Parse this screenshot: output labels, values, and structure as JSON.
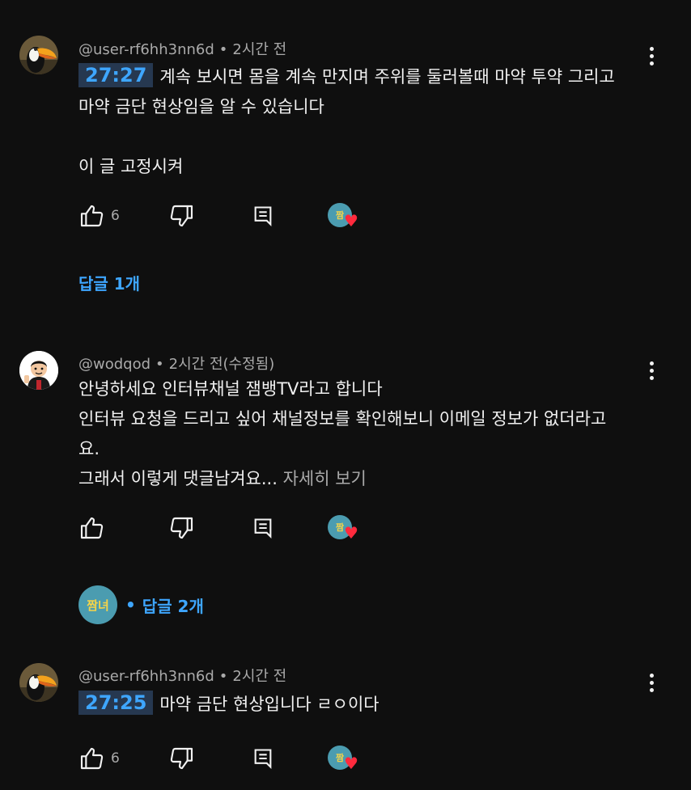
{
  "colors": {
    "background": "#0f0f0f",
    "text": "#f1f1f1",
    "muted": "#aaaaaa",
    "link": "#3ea6ff",
    "timestamp_bg": "#263850",
    "heart": "#ff2a3d",
    "creator_avatar": "#4b9cb0"
  },
  "comments": [
    {
      "handle": "@user-rf6hh3nn6d",
      "separator": "•",
      "time": "2시간 전",
      "timestamp": "27:27",
      "line1": "계속 보시면 몸을 계속 만지며 주위를 둘러볼때 마약 투약 그리고",
      "line2": "마약 금단 현상임을 알 수 있습니다",
      "line3": "이 글 고정시켜",
      "likes": "6",
      "creator_badge": "짬",
      "avatar_icon": "toucan-avatar-icon",
      "replies_label": "답글 1개"
    },
    {
      "handle": "@wodqod",
      "separator": "•",
      "time": "2시간 전(수정됨)",
      "line1": "안녕하세요 인터뷰채널 잼뱅TV라고 합니다",
      "line2": "인터뷰 요청을 드리고 싶어 채널정보를 확인해보니 이메일 정보가 없더라고",
      "line3": "요.",
      "line4": "그래서 이렇게 댓글남겨요...",
      "read_more": "자세히 보기",
      "likes": "",
      "creator_badge": "짬",
      "avatar_icon": "cartoon-person-avatar-icon",
      "replies_avatar_text": "짬녀",
      "replies_separator": "•",
      "replies_label": "답글 2개"
    },
    {
      "handle": "@user-rf6hh3nn6d",
      "separator": "•",
      "time": "2시간 전",
      "timestamp": "27:25",
      "line1": "마약 금단 현상입니다 ㄹㅇ이다",
      "likes": "6",
      "creator_badge": "짬",
      "avatar_icon": "toucan-avatar-icon"
    }
  ]
}
